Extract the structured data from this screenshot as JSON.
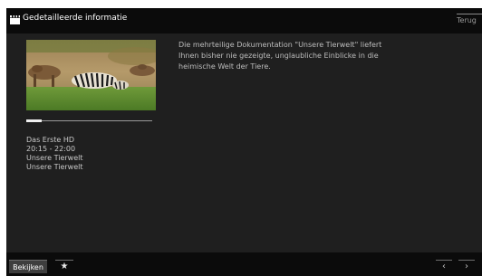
{
  "header": {
    "title": "Gedetailleerde informatie",
    "icon": "clapperboard-icon",
    "back_label": "Terug"
  },
  "program": {
    "channel": "Das Erste HD",
    "time": "20:15 - 22:00",
    "title": "Unsere Tierwelt",
    "subtitle": "Unsere Tierwelt",
    "progress": 0.12,
    "description": "Die mehrteilige Dokumentation \"Unsere Tierwelt\" liefert Ihnen bisher nie gezeigte, unglaubliche Einblicke in die heimische Welt der Tiere."
  },
  "footer": {
    "watch_label": "Bekijken",
    "favorite_icon": "star-icon",
    "favorite_glyph": "★",
    "prev_icon": "chevron-left-icon",
    "prev_glyph": "‹",
    "next_icon": "chevron-right-icon",
    "next_glyph": "›"
  },
  "colors": {
    "background": "#1f1f1f",
    "bar": "#0b0b0b",
    "button": "#3e3e3e"
  }
}
